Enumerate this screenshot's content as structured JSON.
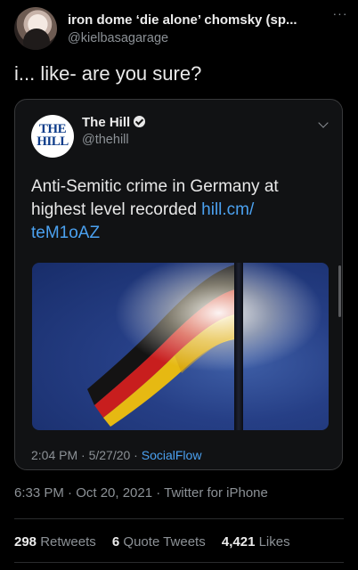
{
  "author": {
    "display_name": "iron dome ‘die alone’ chomsky (sp...",
    "handle": "@kielbasagarage",
    "avatar_icon": "profile-photo",
    "more_icon": "more-options-icon"
  },
  "tweet": {
    "text": "i... like- are you sure?",
    "timestamp": "6:33 PM · Oct 20, 2021 · Twitter for iPhone"
  },
  "quoted": {
    "logo_line1": "THE",
    "logo_line2": "HILL",
    "name": "The Hill",
    "handle": "@thehill",
    "text": "Anti-Semitic crime in Germany at highest level recorded ",
    "link": "hill.cm/ teM1oAZ",
    "meta_time": "2:04 PM · 5/27/20 · ",
    "meta_source": "SocialFlow",
    "link_color": "#4ba1f0"
  },
  "stats": {
    "retweets_count": "298",
    "retweets_label": "Retweets",
    "quotes_count": "6",
    "quotes_label": "Quote Tweets",
    "likes_count": "4,421",
    "likes_label": "Likes"
  }
}
